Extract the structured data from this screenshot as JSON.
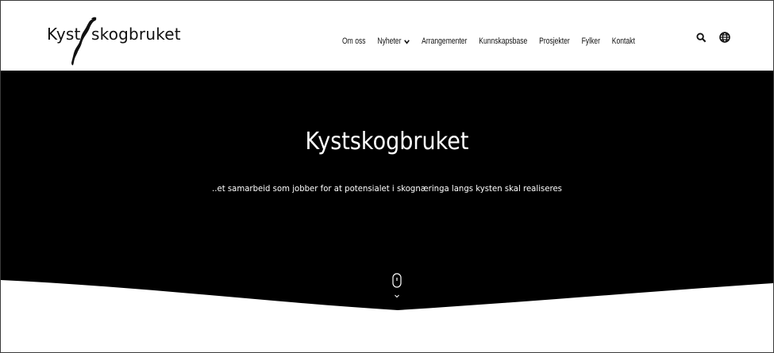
{
  "logo": {
    "left_text": "Kyst",
    "right_text": "skogbruket"
  },
  "nav": {
    "items": [
      {
        "label": "Om oss"
      },
      {
        "label": "Nyheter",
        "has_dropdown": true
      },
      {
        "label": "Arrangementer"
      },
      {
        "label": "Kunnskapsbase"
      },
      {
        "label": "Prosjekter"
      },
      {
        "label": "Fylker"
      },
      {
        "label": "Kontakt"
      }
    ],
    "icons": [
      "search-icon",
      "globe-icon"
    ]
  },
  "hero": {
    "title": "Kystskogbruket",
    "subtitle": "..et samarbeid som jobber for at potensialet i skognæringa langs kysten skal realiseres"
  },
  "colors": {
    "hero_bg": "#000000",
    "page_bg": "#ffffff",
    "text_dark": "#111111",
    "text_light": "#ffffff"
  }
}
